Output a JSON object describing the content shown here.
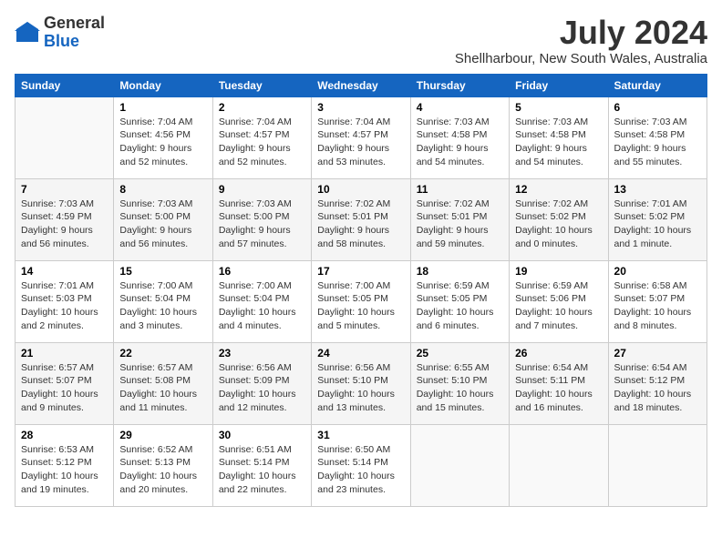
{
  "header": {
    "logo_line1": "General",
    "logo_line2": "Blue",
    "month_year": "July 2024",
    "location": "Shellharbour, New South Wales, Australia"
  },
  "days_of_week": [
    "Sunday",
    "Monday",
    "Tuesday",
    "Wednesday",
    "Thursday",
    "Friday",
    "Saturday"
  ],
  "weeks": [
    [
      {
        "day": "",
        "info": ""
      },
      {
        "day": "1",
        "info": "Sunrise: 7:04 AM\nSunset: 4:56 PM\nDaylight: 9 hours\nand 52 minutes."
      },
      {
        "day": "2",
        "info": "Sunrise: 7:04 AM\nSunset: 4:57 PM\nDaylight: 9 hours\nand 52 minutes."
      },
      {
        "day": "3",
        "info": "Sunrise: 7:04 AM\nSunset: 4:57 PM\nDaylight: 9 hours\nand 53 minutes."
      },
      {
        "day": "4",
        "info": "Sunrise: 7:03 AM\nSunset: 4:58 PM\nDaylight: 9 hours\nand 54 minutes."
      },
      {
        "day": "5",
        "info": "Sunrise: 7:03 AM\nSunset: 4:58 PM\nDaylight: 9 hours\nand 54 minutes."
      },
      {
        "day": "6",
        "info": "Sunrise: 7:03 AM\nSunset: 4:58 PM\nDaylight: 9 hours\nand 55 minutes."
      }
    ],
    [
      {
        "day": "7",
        "info": "Sunrise: 7:03 AM\nSunset: 4:59 PM\nDaylight: 9 hours\nand 56 minutes."
      },
      {
        "day": "8",
        "info": "Sunrise: 7:03 AM\nSunset: 5:00 PM\nDaylight: 9 hours\nand 56 minutes."
      },
      {
        "day": "9",
        "info": "Sunrise: 7:03 AM\nSunset: 5:00 PM\nDaylight: 9 hours\nand 57 minutes."
      },
      {
        "day": "10",
        "info": "Sunrise: 7:02 AM\nSunset: 5:01 PM\nDaylight: 9 hours\nand 58 minutes."
      },
      {
        "day": "11",
        "info": "Sunrise: 7:02 AM\nSunset: 5:01 PM\nDaylight: 9 hours\nand 59 minutes."
      },
      {
        "day": "12",
        "info": "Sunrise: 7:02 AM\nSunset: 5:02 PM\nDaylight: 10 hours\nand 0 minutes."
      },
      {
        "day": "13",
        "info": "Sunrise: 7:01 AM\nSunset: 5:02 PM\nDaylight: 10 hours\nand 1 minute."
      }
    ],
    [
      {
        "day": "14",
        "info": "Sunrise: 7:01 AM\nSunset: 5:03 PM\nDaylight: 10 hours\nand 2 minutes."
      },
      {
        "day": "15",
        "info": "Sunrise: 7:00 AM\nSunset: 5:04 PM\nDaylight: 10 hours\nand 3 minutes."
      },
      {
        "day": "16",
        "info": "Sunrise: 7:00 AM\nSunset: 5:04 PM\nDaylight: 10 hours\nand 4 minutes."
      },
      {
        "day": "17",
        "info": "Sunrise: 7:00 AM\nSunset: 5:05 PM\nDaylight: 10 hours\nand 5 minutes."
      },
      {
        "day": "18",
        "info": "Sunrise: 6:59 AM\nSunset: 5:05 PM\nDaylight: 10 hours\nand 6 minutes."
      },
      {
        "day": "19",
        "info": "Sunrise: 6:59 AM\nSunset: 5:06 PM\nDaylight: 10 hours\nand 7 minutes."
      },
      {
        "day": "20",
        "info": "Sunrise: 6:58 AM\nSunset: 5:07 PM\nDaylight: 10 hours\nand 8 minutes."
      }
    ],
    [
      {
        "day": "21",
        "info": "Sunrise: 6:57 AM\nSunset: 5:07 PM\nDaylight: 10 hours\nand 9 minutes."
      },
      {
        "day": "22",
        "info": "Sunrise: 6:57 AM\nSunset: 5:08 PM\nDaylight: 10 hours\nand 11 minutes."
      },
      {
        "day": "23",
        "info": "Sunrise: 6:56 AM\nSunset: 5:09 PM\nDaylight: 10 hours\nand 12 minutes."
      },
      {
        "day": "24",
        "info": "Sunrise: 6:56 AM\nSunset: 5:10 PM\nDaylight: 10 hours\nand 13 minutes."
      },
      {
        "day": "25",
        "info": "Sunrise: 6:55 AM\nSunset: 5:10 PM\nDaylight: 10 hours\nand 15 minutes."
      },
      {
        "day": "26",
        "info": "Sunrise: 6:54 AM\nSunset: 5:11 PM\nDaylight: 10 hours\nand 16 minutes."
      },
      {
        "day": "27",
        "info": "Sunrise: 6:54 AM\nSunset: 5:12 PM\nDaylight: 10 hours\nand 18 minutes."
      }
    ],
    [
      {
        "day": "28",
        "info": "Sunrise: 6:53 AM\nSunset: 5:12 PM\nDaylight: 10 hours\nand 19 minutes."
      },
      {
        "day": "29",
        "info": "Sunrise: 6:52 AM\nSunset: 5:13 PM\nDaylight: 10 hours\nand 20 minutes."
      },
      {
        "day": "30",
        "info": "Sunrise: 6:51 AM\nSunset: 5:14 PM\nDaylight: 10 hours\nand 22 minutes."
      },
      {
        "day": "31",
        "info": "Sunrise: 6:50 AM\nSunset: 5:14 PM\nDaylight: 10 hours\nand 23 minutes."
      },
      {
        "day": "",
        "info": ""
      },
      {
        "day": "",
        "info": ""
      },
      {
        "day": "",
        "info": ""
      }
    ]
  ]
}
